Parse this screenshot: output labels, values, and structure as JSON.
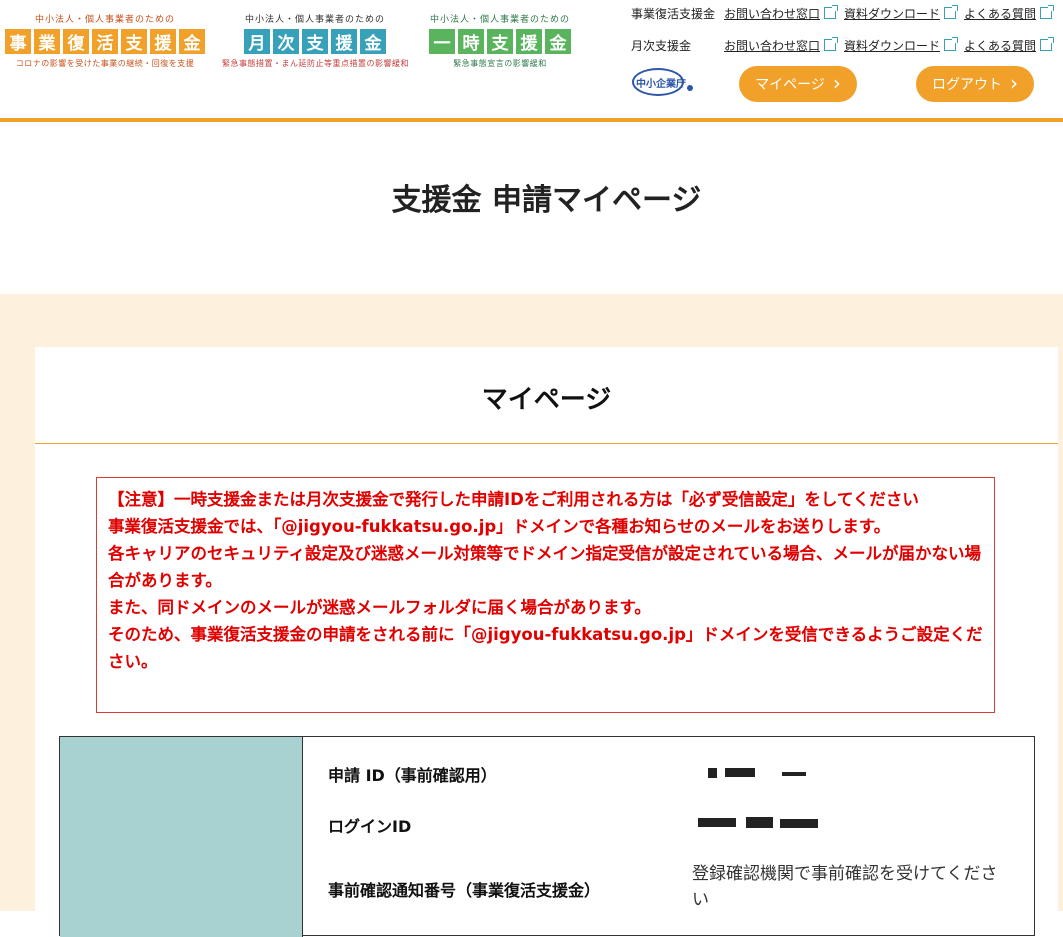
{
  "header": {
    "logos": [
      {
        "caption": "中小法人・個人事業者のための",
        "chars": [
          "事",
          "業",
          "復",
          "活",
          "支",
          "援",
          "金"
        ],
        "subtitle": "コロナの影響を受けた事業の継続・回復を支援"
      },
      {
        "caption": "中小法人・個人事業者のための",
        "chars": [
          "月",
          "次",
          "支",
          "援",
          "金"
        ],
        "subtitle": "緊急事態措置・まん延防止等重点措置の影響緩和"
      },
      {
        "caption": "中小法人・個人事業者のための",
        "chars": [
          "一",
          "時",
          "支",
          "援",
          "金"
        ],
        "subtitle": "緊急事態宣言の影響緩和"
      }
    ],
    "nav_rows": [
      {
        "label": "事業復活支援金",
        "links": [
          "お問い合わせ窓口",
          "資料ダウンロード",
          "よくある質問"
        ]
      },
      {
        "label": "月次支援金",
        "links": [
          "お問い合わせ窓口",
          "資料ダウンロード",
          "よくある質問"
        ]
      }
    ],
    "agency_logo_text": "中小企業庁",
    "mypage_label": "マイページ",
    "logout_label": "ログアウト",
    "accent_color": "#f1a12a"
  },
  "page": {
    "title": "支援金 申請マイページ"
  },
  "card": {
    "title": "マイページ",
    "notice_lines": [
      "【注意】一時支援金または月次支援金で発行した申請IDをご利用される方は「必ず受信設定」をしてください",
      "事業復活支援金では、「@jigyou-fukkatsu.go.jp」ドメインで各種お知らせのメールをお送りします。",
      "各キャリアのセキュリティ設定及び迷惑メール対策等でドメイン指定受信が設定されている場合、メールが届かない場合があります。",
      "また、同ドメインのメールが迷惑メールフォルダに届く場合があります。",
      "そのため、事業復活支援金の申請をされる前に「@jigyou-fukkatsu.go.jp」ドメインを受信できるようご設定ください。"
    ],
    "notice_color": "#e00000",
    "info": {
      "application_id_label": "申請 ID（事前確認用）",
      "login_id_label": "ログインID",
      "notification_label": "事前確認通知番号（事業復活支援金）",
      "notification_value": "登録確認機関で事前確認を受けてください"
    }
  }
}
